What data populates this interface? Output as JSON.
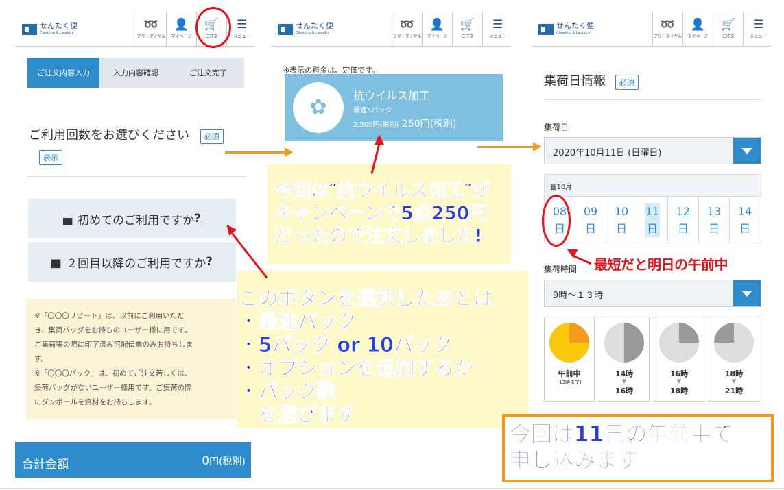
{
  "brand": {
    "name": "せんたく便",
    "sub": "Cleaning & Laundry"
  },
  "nav": {
    "free": "フリーダイヤル",
    "mypage": "マイページ",
    "order": "ご注文",
    "menu": "メニュー"
  },
  "steps": [
    "ご注文内容入力",
    "入力内容確認",
    "ご注文完了"
  ],
  "p1": {
    "question": "ご利用回数をお選びください",
    "required": "必須",
    "show": "表示",
    "first_btn": "初めてのご利用ですか",
    "repeat_btn": "２回目以降のご利用ですか",
    "qmark": "?",
    "note": [
      "※「〇〇〇リピート」は、以前にご利用いただ",
      "き、集荷バッグをお持ちのユーザー様に用です。",
      "ご集荷等の際に印字済み宅配伝票のみお持ちしま",
      "す。",
      "※「〇〇〇パック」は、初めてご注文若しくは、",
      "集荷バッグがないユーザー様用です。ご集荷の際",
      "にダンボールを資材をお持ちします。"
    ],
    "total_label": "合計金額",
    "total_value": "0",
    "total_unit": "円(税別)"
  },
  "p2": {
    "notice": "※表示の料金は、定価です。",
    "product_name": "抗ウイルス加工",
    "product_sub": "最速5パック",
    "old_price": "2,500円(税別)",
    "new_price": "250円(税別)"
  },
  "p3": {
    "title": "集荷日情報",
    "required": "必須",
    "date_label": "集荷日",
    "date_value": "2020年10月11日 (日曜日)",
    "month": "10月",
    "days": [
      "08",
      "09",
      "10",
      "11",
      "12",
      "13",
      "14"
    ],
    "day_suffix": "日",
    "time_label": "集荷時間",
    "time_value": "9時～１３時",
    "slots": [
      {
        "top": "午前中",
        "sub": "(13時まで)",
        "bottom": ""
      },
      {
        "top": "14時",
        "sub": "",
        "bottom": "16時"
      },
      {
        "top": "16時",
        "sub": "",
        "bottom": "18時"
      },
      {
        "top": "18時",
        "sub": "",
        "bottom": "21時"
      }
    ]
  },
  "annotations": {
    "campaign": [
      "今回は″抗ウイルス加工″が",
      "キャンペーンで5点250円",
      "だったので注文しました!"
    ],
    "steps_title": "このボタンを選択したあとは",
    "steps_list": [
      "・最速パック",
      "・5パック or 10パック",
      "・オプションを追加するか",
      "・パック数",
      "　を選びます"
    ],
    "earliest": "最短だと明日の午前中",
    "decision": [
      "今回は11日の午前中で",
      "申し込みます"
    ]
  },
  "colors": {
    "accent": "#2f8ccc",
    "callout_text": "#2a3ed8",
    "highlight": "#fdf9c9",
    "circle": "#e3141c",
    "orange": "#f39a1e"
  }
}
